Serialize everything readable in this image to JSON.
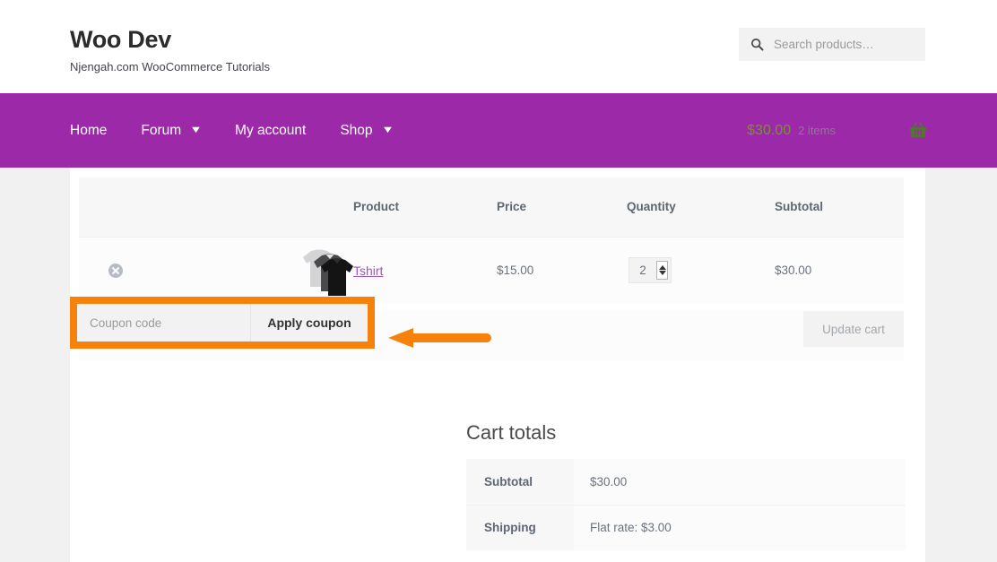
{
  "header": {
    "site_title": "Woo Dev",
    "tagline": "Njengah.com WooCommerce Tutorials",
    "search": {
      "placeholder": "Search products…",
      "icon": "search-icon",
      "value": ""
    }
  },
  "nav": {
    "bar_color": "#9c2aa8",
    "items": [
      {
        "label": "Home",
        "has_dropdown": false
      },
      {
        "label": "Forum",
        "has_dropdown": true,
        "caret": "▼"
      },
      {
        "label": "My account",
        "has_dropdown": false
      },
      {
        "label": "Shop",
        "has_dropdown": true,
        "caret": "▼"
      }
    ],
    "cart": {
      "total": "$30.00",
      "count": "2 items",
      "icon": "shopping-basket-icon",
      "icon_color": "#4f7a28"
    }
  },
  "cart_table": {
    "columns": [
      "",
      "",
      "Product",
      "Price",
      "Quantity",
      "Subtotal"
    ],
    "rows": [
      {
        "remove_icon": "remove-item-icon",
        "thumbnail": "tshirt-product-thumbnail",
        "product": "Tshirt",
        "price": "$15.00",
        "quantity": "2",
        "subtotal": "$30.00"
      }
    ]
  },
  "coupon": {
    "placeholder": "Coupon code",
    "value": "",
    "apply_label": "Apply coupon",
    "highlight_color": "#f7820b",
    "annotation_arrow": "left-pointing-arrow"
  },
  "update_cart": {
    "label": "Update cart",
    "disabled": true
  },
  "cart_totals": {
    "heading": "Cart totals",
    "rows": [
      {
        "label": "Subtotal",
        "value": "$30.00"
      },
      {
        "label": "Shipping",
        "value": "Flat rate: $3.00"
      }
    ]
  }
}
